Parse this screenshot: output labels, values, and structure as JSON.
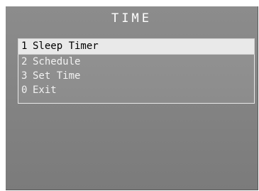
{
  "screen": {
    "title": "TIME"
  },
  "menu": {
    "items": [
      {
        "number": "1",
        "label": "Sleep Timer",
        "selected": true
      },
      {
        "number": "2",
        "label": "Schedule",
        "selected": false
      },
      {
        "number": "3",
        "label": "Set Time",
        "selected": false
      },
      {
        "number": "0",
        "label": "Exit",
        "selected": false
      }
    ]
  },
  "colors": {
    "background": "#7f7f7f",
    "text": "#f2f2f2",
    "highlight": "#e9e9e9",
    "highlight_text": "#000000"
  }
}
